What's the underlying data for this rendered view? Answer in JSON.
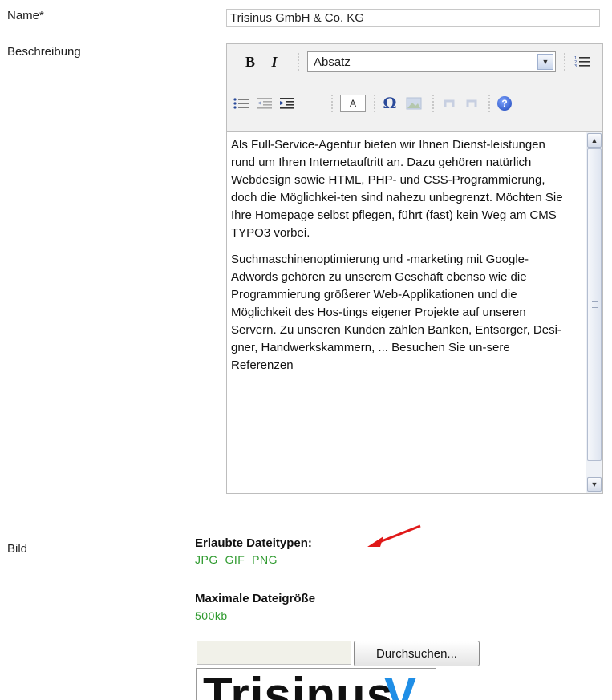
{
  "form": {
    "name_label": "Name*",
    "name_value": "Trisinus GmbH & Co. KG",
    "description_label": "Beschreibung",
    "image_label": "Bild"
  },
  "editor": {
    "toolbar": {
      "bold": "B",
      "italic": "I",
      "format_select_value": "Absatz",
      "font_color_label": "A",
      "special_char": "Ω",
      "help": "?"
    },
    "paragraphs": [
      "Als Full-Service-Agentur bieten wir Ihnen Dienst-leistungen rund um Ihren Internetauftritt an. Dazu gehören natürlich Webdesign sowie HTML, PHP- und CSS-Programmierung, doch die Möglichkei-ten sind nahezu unbegrenzt. Möchten Sie Ihre Homepage selbst pflegen, führt (fast) kein Weg am CMS TYPO3 vorbei.",
      "Suchmaschinenoptimierung und -marketing mit Google-Adwords gehören zu unserem Geschäft ebenso wie die Programmierung größerer Web-Applikationen und die Möglichkeit des Hos-tings eigener  Projekte auf unseren Servern.  Zu unseren Kunden zählen Banken, Entsorger, Desi-gner, Handwerkskammern, ... Besuchen Sie un-sere Referenzen"
    ]
  },
  "upload": {
    "allowed_types_title": "Erlaubte Dateitypen:",
    "allowed_types": "JPG  GIF  PNG",
    "max_size_title": "Maximale Dateigröße",
    "max_size": "500kb",
    "browse_label": "Durchsuchen...",
    "logo_text": "Trisinus",
    "logo_mark": "V"
  },
  "colors": {
    "allowed_value_green": "#2e9a2e",
    "annotation_arrow_red": "#e01818",
    "logo_blue": "#1f8ee6"
  }
}
